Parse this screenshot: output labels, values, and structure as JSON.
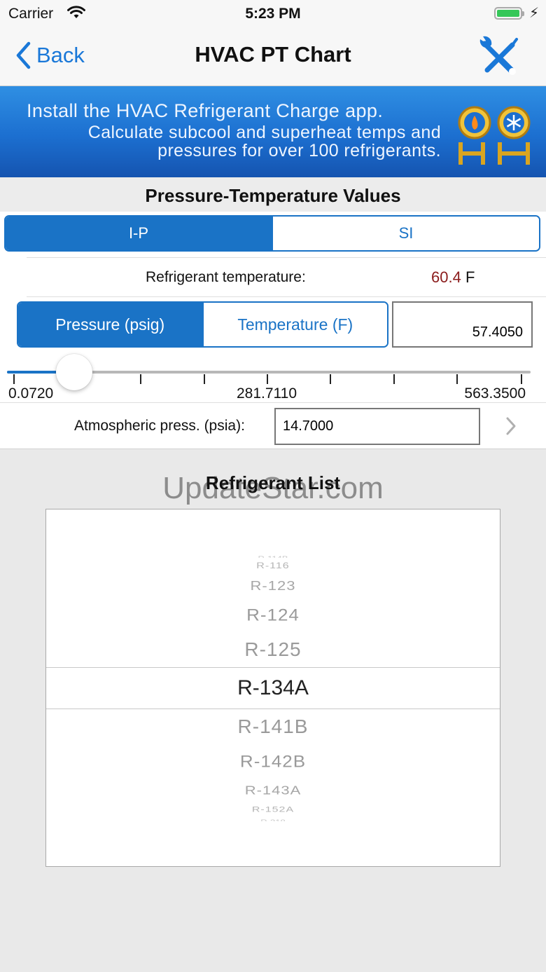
{
  "status_bar": {
    "carrier": "Carrier",
    "time": "5:23 PM"
  },
  "nav": {
    "back_label": "Back",
    "title": "HVAC PT Chart"
  },
  "banner": {
    "line1": "Install the HVAC Refrigerant Charge app.",
    "line2": "Calculate subcool and superheat temps and",
    "line3": "pressures for over 100 refrigerants."
  },
  "pt_section": {
    "title": "Pressure-Temperature Values",
    "unit_tabs": [
      "I-P",
      "SI"
    ],
    "selected_unit": "I-P",
    "refrigerant_temp_label": "Refrigerant temperature:",
    "refrigerant_temp_value": "60.4",
    "refrigerant_temp_unit": "F",
    "mode_tabs": [
      "Pressure (psig)",
      "Temperature (F)"
    ],
    "selected_mode": "Pressure (psig)",
    "value": "57.4050",
    "slider": {
      "min_label": "0.0720",
      "mid_label": "281.7110",
      "max_label": "563.3500",
      "min": 0.072,
      "max": 563.35,
      "value": 57.405
    },
    "atm_label": "Atmospheric press. (psia):",
    "atm_value": "14.7000"
  },
  "watermark": "UpdateStar.com",
  "refrigerant_list": {
    "title": "Refrigerant List",
    "items": [
      "R-116",
      "R-123",
      "R-124",
      "R-125",
      "R-134A",
      "R-141B",
      "R-142B",
      "R-143A",
      "R-152A"
    ],
    "selected": "R-134A"
  },
  "colors": {
    "accent": "#1a73c6",
    "back_link": "#1a78d8",
    "temperature_value": "#8b1c1c",
    "battery": "#35c759",
    "banner": "#1c6fd0"
  }
}
